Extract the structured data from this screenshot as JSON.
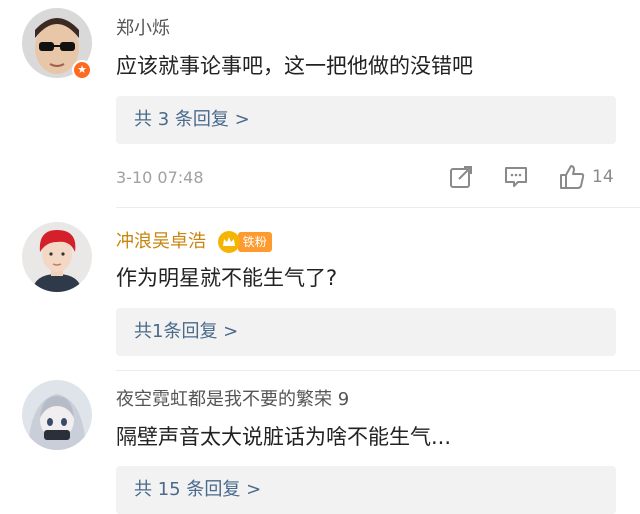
{
  "comments": [
    {
      "username": "郑小烁",
      "text": "应该就事论事吧，这一把他做的没错吧",
      "replies_label": "共 3 条回复 >",
      "timestamp": "3-10 07:48",
      "likes": "14",
      "avatar_icon": "boy-with-sunglasses-avatar",
      "verified_icon": "orange-star-badge"
    },
    {
      "username": "冲浪吴卓浩",
      "badge_label": "铁粉",
      "text": "作为明星就不能生气了?",
      "replies_label": "共1条回复 >",
      "avatar_icon": "red-hair-man-avatar"
    },
    {
      "username": "夜空霓虹都是我不要的繁荣 9",
      "text": "隔壁声音太大说脏话为啥不能生气...",
      "replies_label": "共 15 条回复 >",
      "avatar_icon": "anime-girl-avatar"
    }
  ],
  "colors": {
    "username_gold": "#c9860f",
    "reply_link": "#4a6a8c",
    "reply_bg": "#f2f2f2",
    "badge_orange": "#ff9a2e"
  }
}
